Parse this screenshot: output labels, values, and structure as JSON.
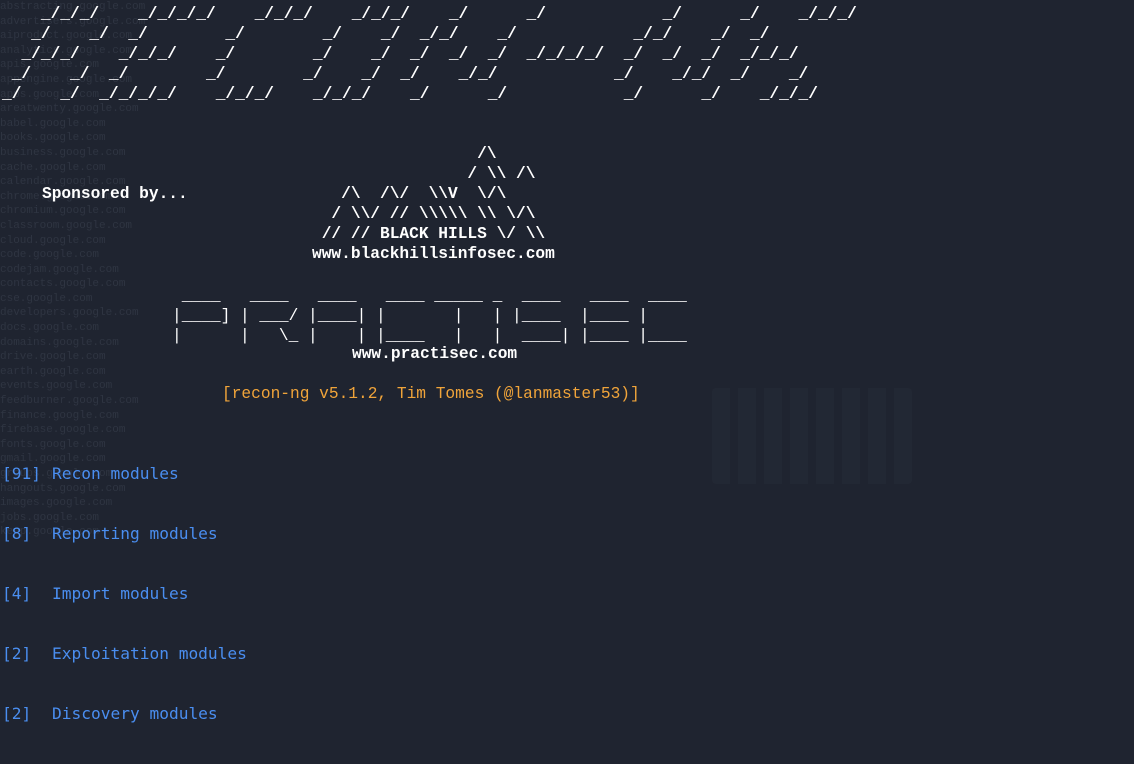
{
  "terminal": {
    "background_color": "#1f2430",
    "text_color": "#ffffff",
    "accent_color": "#f0a43a",
    "link_color": "#4a8ef0"
  },
  "banner": {
    "ascii_art": "    _/_/_/    _/_/_/_/    _/_/_/    _/_/_/    _/      _/            _/      _/    _/_/_/\n   _/    _/  _/        _/        _/    _/  _/_/    _/            _/_/    _/  _/\n  _/_/_/    _/_/_/    _/        _/    _/  _/  _/  _/  _/_/_/_/  _/  _/  _/  _/_/_/\n _/    _/  _/        _/        _/    _/  _/    _/_/            _/    _/_/  _/    _/\n_/    _/  _/_/_/_/    _/_/_/    _/_/_/    _/      _/            _/      _/    _/_/_/"
  },
  "sponsor": {
    "label": "Sponsored by...",
    "mountain_art": "                 /\\\n                / \\\\ /\\\n   /\\  /\\/  \\\\V  \\/\\\n  / \\\\/ // \\\\\\\\\\ \\\\ \\/\\\n // // BLACK HILLS \\/ \\\\",
    "url": "www.blackhillsinfosec.com"
  },
  "practisec": {
    "ascii_art": " ____   ____   ____   ____ _____ _  ____   ____  ____\n|____] | ___/ |____| |       |   | |____  |____ |\n|      |   \\_ |    | |____   |   |  ____| |____ |____",
    "url": "www.practisec.com"
  },
  "version_line": "[recon-ng v5.1.2, Tim Tomes (@lanmaster53)]",
  "modules": [
    {
      "count": "[91]",
      "label": "Recon modules"
    },
    {
      "count": "[8]",
      "label": "Reporting modules"
    },
    {
      "count": "[4]",
      "label": "Import modules"
    },
    {
      "count": "[2]",
      "label": "Exploitation modules"
    },
    {
      "count": "[2]",
      "label": "Discovery modules"
    }
  ]
}
